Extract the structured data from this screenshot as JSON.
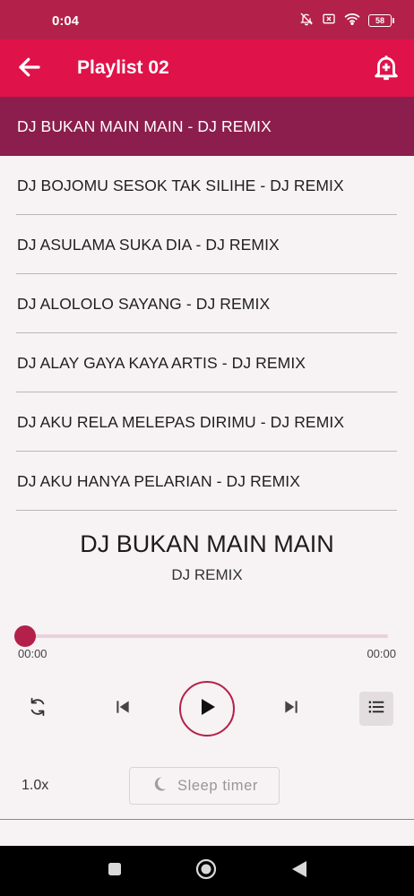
{
  "status": {
    "time": "0:04",
    "battery": "58",
    "icons": [
      "bell-muted-icon",
      "sim-off-icon",
      "wifi-icon",
      "battery-icon"
    ]
  },
  "appbar": {
    "title": "Playlist 02",
    "back_icon": "arrow-left-icon",
    "action_icon": "alarm-add-icon"
  },
  "tracks": [
    {
      "label": "DJ BUKAN MAIN MAIN - DJ REMIX",
      "active": true
    },
    {
      "label": "DJ BOJOMU SESOK TAK SILIHE - DJ REMIX",
      "active": false
    },
    {
      "label": "DJ ASULAMA SUKA DIA - DJ REMIX",
      "active": false
    },
    {
      "label": "DJ ALOLOLO SAYANG - DJ REMIX",
      "active": false
    },
    {
      "label": "DJ ALAY GAYA KAYA ARTIS - DJ REMIX",
      "active": false
    },
    {
      "label": "DJ AKU RELA MELEPAS DIRIMU - DJ REMIX",
      "active": false
    },
    {
      "label": "DJ AKU HANYA PELARIAN - DJ REMIX",
      "active": false
    }
  ],
  "player": {
    "title": "DJ BUKAN MAIN MAIN",
    "artist": "DJ REMIX",
    "current_time": "00:00",
    "total_time": "00:00",
    "progress": 0,
    "speed": "1.0x",
    "sleep_timer_label": "Sleep timer",
    "controls": [
      "repeat-icon",
      "skip-previous-icon",
      "play-icon",
      "skip-next-icon",
      "queue-list-icon"
    ]
  },
  "colors": {
    "accent": "#e0124a",
    "accent_dark": "#b3214a",
    "selected_row": "#8b1e4d",
    "background": "#f7f2f4"
  }
}
